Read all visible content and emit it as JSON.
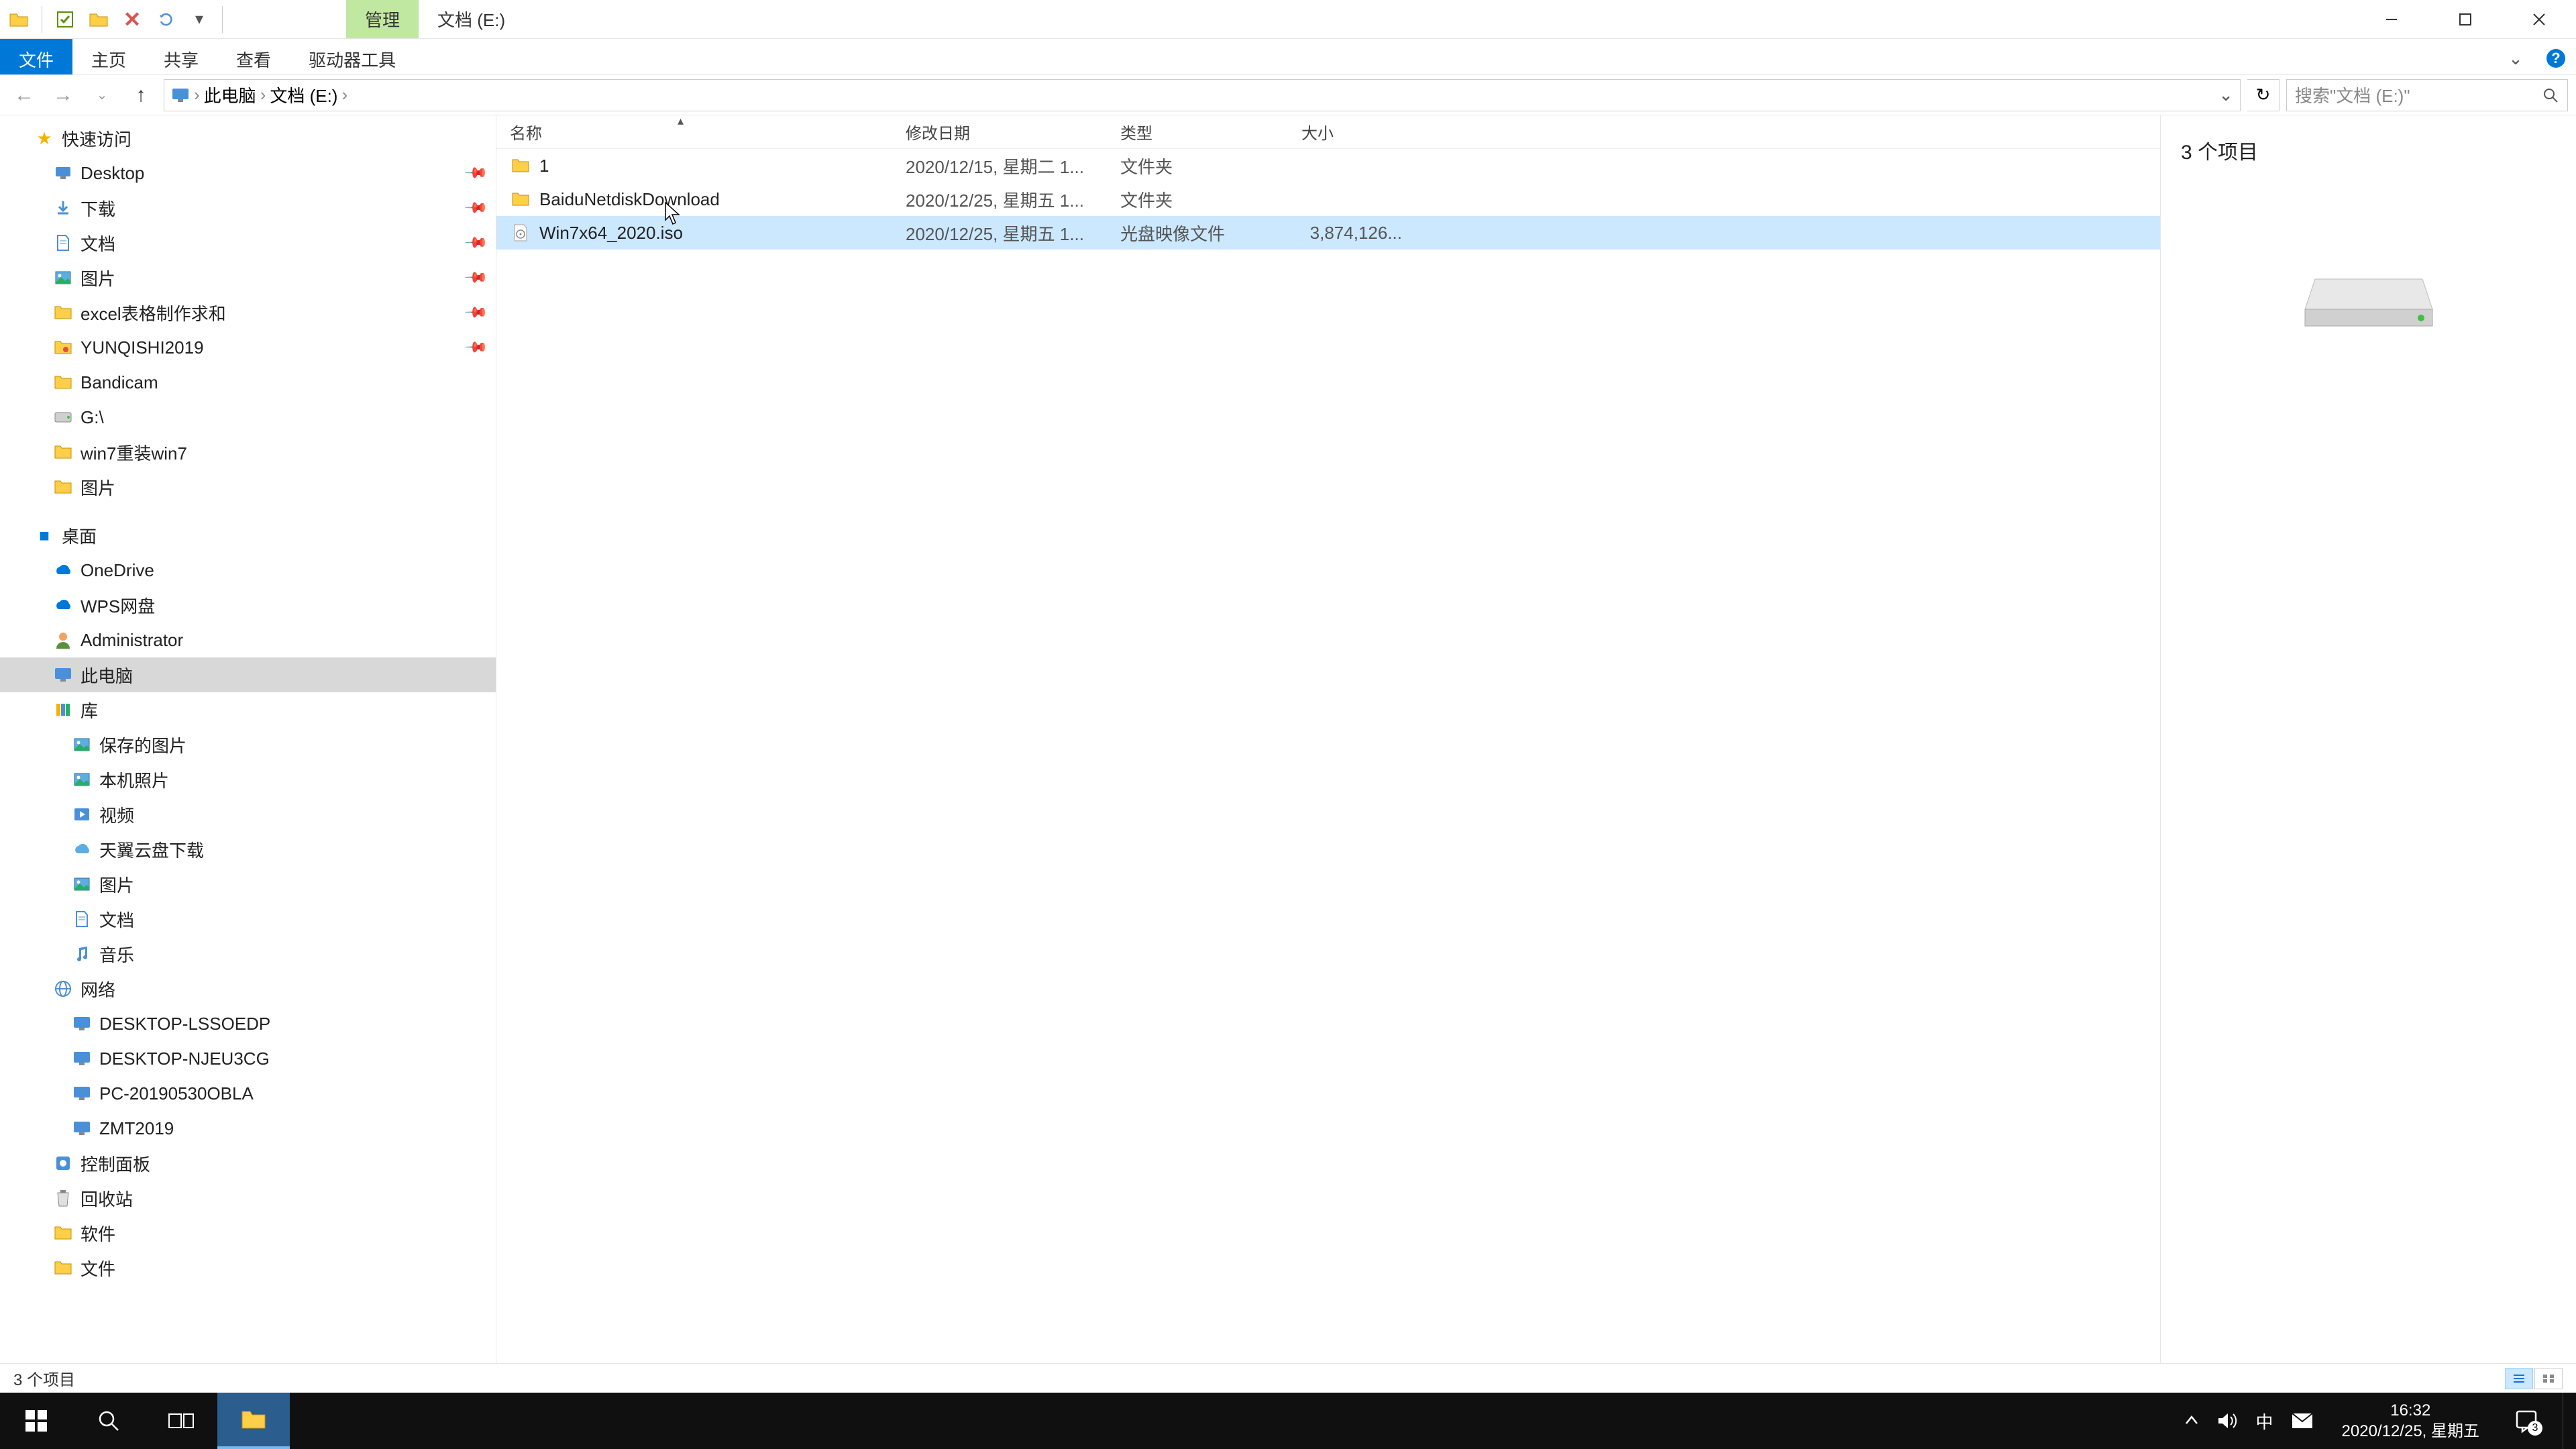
{
  "titlebar": {
    "contextual_tab": "管理",
    "location_title": "文档 (E:)"
  },
  "ribbon": {
    "file": "文件",
    "home": "主页",
    "share": "共享",
    "view": "查看",
    "drive_tools": "驱动器工具"
  },
  "address": {
    "root": "此电脑",
    "current": "文档 (E:)"
  },
  "search": {
    "placeholder": "搜索\"文档 (E:)\""
  },
  "columns": {
    "name": "名称",
    "date": "修改日期",
    "type": "类型",
    "size": "大小"
  },
  "rows": [
    {
      "icon": "folder",
      "name": "1",
      "date": "2020/12/15, 星期二 1...",
      "type": "文件夹",
      "size": ""
    },
    {
      "icon": "folder",
      "name": "BaiduNetdiskDownload",
      "date": "2020/12/25, 星期五 1...",
      "type": "文件夹",
      "size": ""
    },
    {
      "icon": "iso",
      "name": "Win7x64_2020.iso",
      "date": "2020/12/25, 星期五 1...",
      "type": "光盘映像文件",
      "size": "3,874,126...",
      "selected": true
    }
  ],
  "nav": {
    "quick_access": "快速访问",
    "qa_items": [
      {
        "icon": "desktop",
        "label": "Desktop",
        "pinned": true
      },
      {
        "icon": "downloads",
        "label": "下载",
        "pinned": true
      },
      {
        "icon": "documents",
        "label": "文档",
        "pinned": true
      },
      {
        "icon": "pictures",
        "label": "图片",
        "pinned": true
      },
      {
        "icon": "folder",
        "label": "excel表格制作求和",
        "pinned": true
      },
      {
        "icon": "folder-app",
        "label": "YUNQISHI2019",
        "pinned": true
      },
      {
        "icon": "folder",
        "label": "Bandicam",
        "pinned": false
      },
      {
        "icon": "drive",
        "label": "G:\\",
        "pinned": false
      },
      {
        "icon": "folder",
        "label": "win7重装win7",
        "pinned": false
      },
      {
        "icon": "folder",
        "label": "图片",
        "pinned": false
      }
    ],
    "desktop": "桌面",
    "desktop_items": [
      {
        "icon": "onedrive",
        "label": "OneDrive"
      },
      {
        "icon": "wps",
        "label": "WPS网盘"
      },
      {
        "icon": "user",
        "label": "Administrator"
      },
      {
        "icon": "pc",
        "label": "此电脑",
        "selected": true
      },
      {
        "icon": "libraries",
        "label": "库"
      }
    ],
    "lib_items": [
      {
        "icon": "pictures-lib",
        "label": "保存的图片"
      },
      {
        "icon": "pictures-lib",
        "label": "本机照片"
      },
      {
        "icon": "videos",
        "label": "视频"
      },
      {
        "icon": "cloud-folder",
        "label": "天翼云盘下载"
      },
      {
        "icon": "pictures-lib",
        "label": "图片"
      },
      {
        "icon": "documents-lib",
        "label": "文档"
      },
      {
        "icon": "music",
        "label": "音乐"
      }
    ],
    "network": "网络",
    "network_items": [
      {
        "label": "DESKTOP-LSSOEDP"
      },
      {
        "label": "DESKTOP-NJEU3CG"
      },
      {
        "label": "PC-20190530OBLA"
      },
      {
        "label": "ZMT2019"
      }
    ],
    "control_panel": "控制面板",
    "recycle_bin": "回收站",
    "software": "软件",
    "documents": "文件"
  },
  "preview": {
    "item_count": "3 个项目"
  },
  "statusbar": {
    "text": "3 个项目"
  },
  "taskbar": {
    "time": "16:32",
    "date": "2020/12/25, 星期五",
    "ime": "中",
    "notif_count": "3"
  }
}
